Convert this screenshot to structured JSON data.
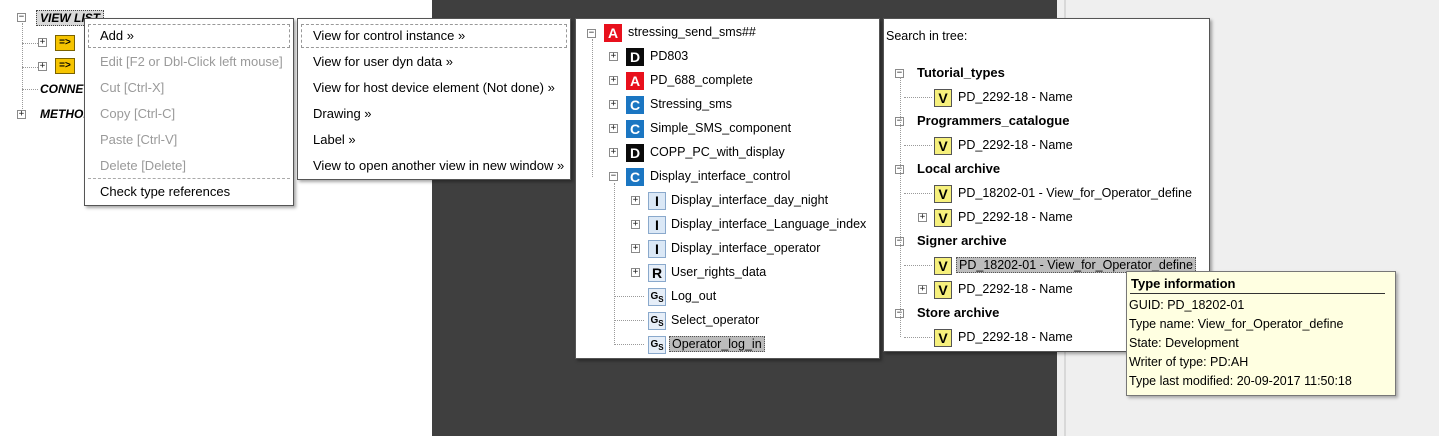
{
  "left_tree": {
    "root_label": "VIEW LIST",
    "items": [
      {
        "label": "CONNEC"
      },
      {
        "label": "METHOD"
      }
    ],
    "arrow_glyph": "=>"
  },
  "context_menu": {
    "items": [
      {
        "label": "Add »",
        "enabled": true
      },
      {
        "label": "Edit [F2 or Dbl-Click left mouse]",
        "enabled": false
      },
      {
        "label": "Cut [Ctrl-X]",
        "enabled": false
      },
      {
        "label": "Copy [Ctrl-C]",
        "enabled": false
      },
      {
        "label": "Paste [Ctrl-V]",
        "enabled": false
      },
      {
        "label": "Delete [Delete]",
        "enabled": false
      },
      {
        "label": "Check type references",
        "enabled": true
      }
    ]
  },
  "submenu": {
    "items": [
      {
        "label": "View for control instance »"
      },
      {
        "label": "View for user dyn data »"
      },
      {
        "label": "View for host device element (Not done) »"
      },
      {
        "label": "Drawing »"
      },
      {
        "label": "Label »"
      },
      {
        "label": "View to open another view in new window »"
      }
    ]
  },
  "instance_tree": {
    "root": {
      "icon": "A",
      "label": "stressing_send_sms##"
    },
    "children": [
      {
        "icon": "D",
        "label": "PD803"
      },
      {
        "icon": "A",
        "label": "PD_688_complete"
      },
      {
        "icon": "C",
        "label": "Stressing_sms"
      },
      {
        "icon": "C",
        "label": "Simple_SMS_component"
      },
      {
        "icon": "D",
        "label": "COPP_PC_with_display"
      },
      {
        "icon": "C",
        "label": "Display_interface_control"
      }
    ],
    "grandchildren": [
      {
        "icon": "I",
        "label": "Display_interface_day_night"
      },
      {
        "icon": "I",
        "label": "Display_interface_Language_index"
      },
      {
        "icon": "I",
        "label": "Display_interface_operator"
      },
      {
        "icon": "R",
        "label": "User_rights_data"
      },
      {
        "icon": "GS",
        "label": "Log_out"
      },
      {
        "icon": "GS",
        "label": "Select_operator"
      },
      {
        "icon": "GS",
        "label": "Operator_log_in"
      }
    ]
  },
  "type_tree": {
    "search_label": "Search in tree:",
    "groups": [
      {
        "name": "Tutorial_types",
        "items": [
          "PD_2292-18 - Name"
        ]
      },
      {
        "name": "Programmers_catalogue",
        "items": [
          "PD_2292-18 - Name"
        ]
      },
      {
        "name": "Local archive",
        "items": [
          "PD_18202-01 - View_for_Operator_define",
          "PD_2292-18 - Name"
        ]
      },
      {
        "name": "Signer archive",
        "items": [
          "PD_18202-01 - View_for_Operator_define",
          "PD_2292-18 - Name"
        ]
      },
      {
        "name": "Store archive",
        "items": [
          "PD_2292-18 - Name"
        ]
      }
    ],
    "item_icon": "V"
  },
  "tooltip": {
    "title": "Type information",
    "lines": [
      "GUID: PD_18202-01",
      "Type name: View_for_Operator_define",
      "State: Development",
      "Writer of type: PD:AH",
      "Type last modified: 20-09-2017 11:50:18"
    ]
  },
  "colors": {
    "dark_background": "#3f3f3f",
    "selection": "#bcbcbc",
    "tooltip_bg": "#ffffe1",
    "icon_A": "#e8101c",
    "icon_C": "#1b76c2",
    "icon_D": "#0a0a0a",
    "icon_V": "#f6f07c"
  }
}
